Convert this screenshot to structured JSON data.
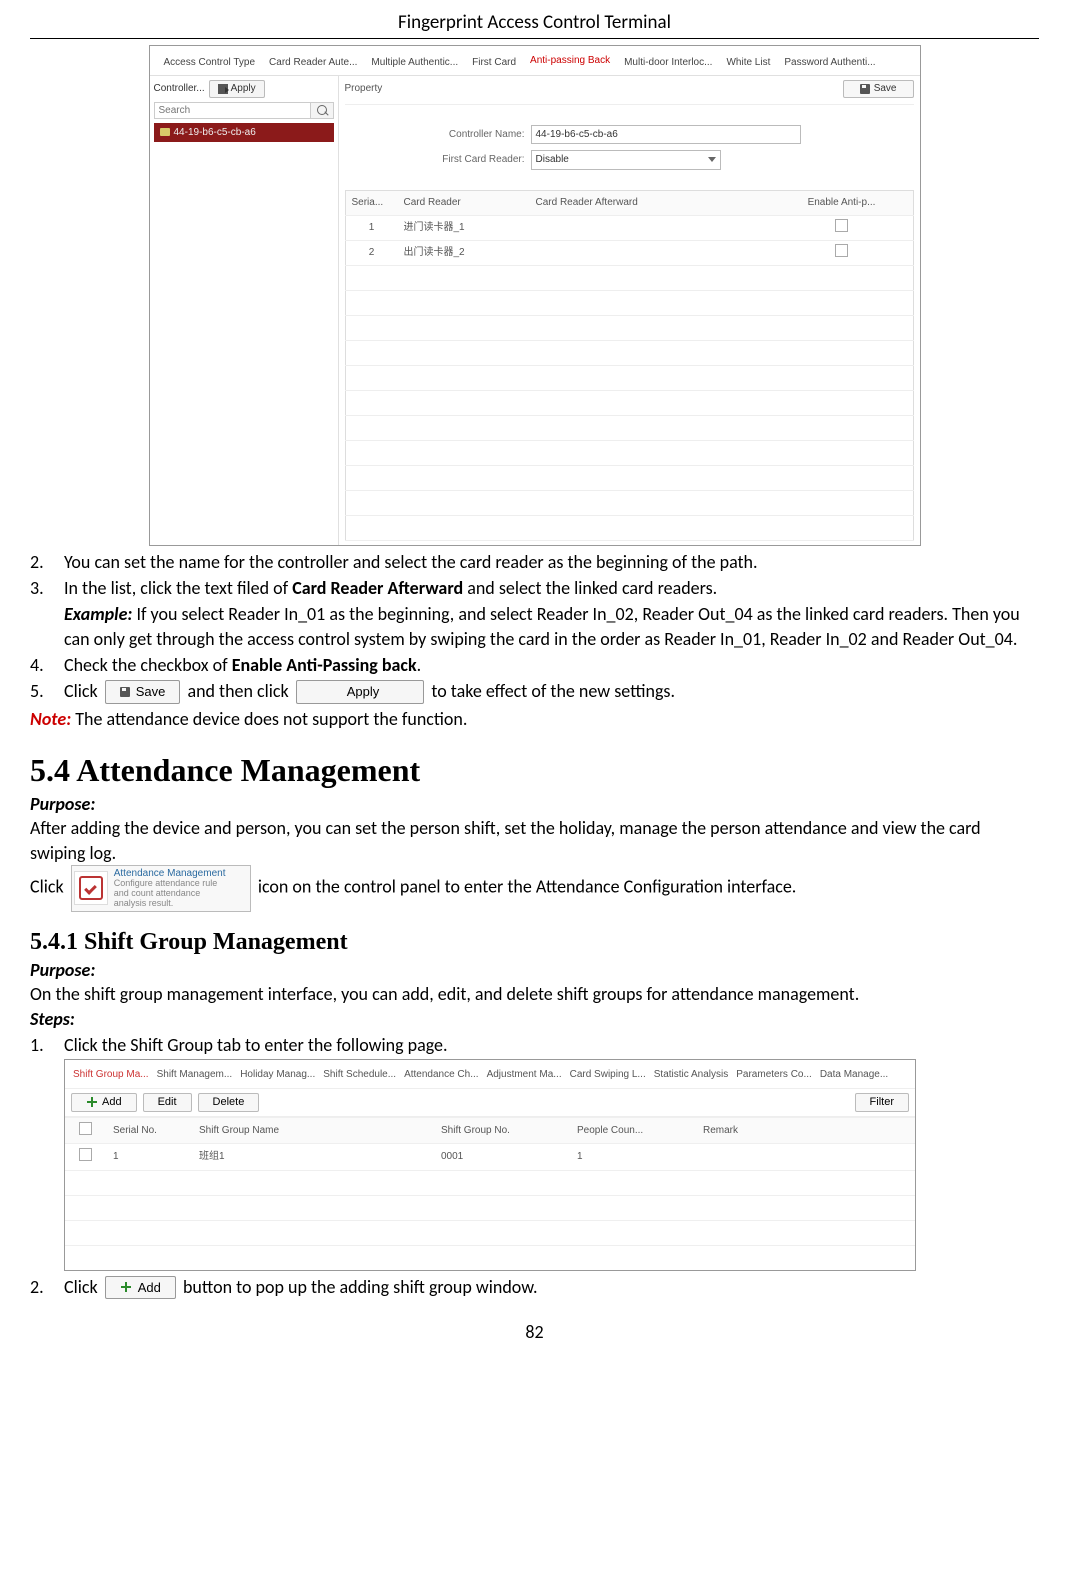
{
  "doc": {
    "header": "Fingerprint Access Control Terminal",
    "pageNumber": "82"
  },
  "panel": {
    "tabs": {
      "t0": "Access Control Type",
      "t1": "Card Reader Aute...",
      "t2": "Multiple Authentic...",
      "t3": "First Card",
      "t4": "Anti-passing Back",
      "t5": "Multi-door Interloc...",
      "t6": "White List",
      "t7": "Password Authenti..."
    },
    "leftLabel": "Controller...",
    "applyLabel": "Apply",
    "searchPlaceholder": "Search",
    "treeItem": "44-19-b6-c5-cb-a6",
    "propTitle": "Property",
    "saveLabel": "Save",
    "form": {
      "controllerNameLabel": "Controller Name:",
      "controllerNameValue": "44-19-b6-c5-cb-a6",
      "firstCardReaderLabel": "First Card Reader:",
      "firstCardReaderValue": "Disable"
    },
    "table": {
      "h0": "Seria...",
      "h1": "Card Reader",
      "h2": "Card Reader Afterward",
      "h3": "Enable Anti-p...",
      "rows": [
        {
          "n": "1",
          "reader": "进门读卡器_1"
        },
        {
          "n": "2",
          "reader": "出门读卡器_2"
        }
      ]
    }
  },
  "text": {
    "it2n": "2.",
    "it2": "You can set the name for the controller and select the card reader as the beginning of the path.",
    "it3n": "3.",
    "it3a": "In the list, click the text filed of ",
    "it3b": "Card Reader Afterward",
    "it3c": " and select the linked card readers.",
    "it3exLabel": "Example:",
    "it3ex": " If you select Reader In_01 as the beginning, and select Reader In_02, Reader Out_04 as the linked card readers. Then you can only get through the access control system by swiping the card in the order as Reader In_01, Reader In_02 and Reader Out_04.",
    "it4n": "4.",
    "it4a": "Check the checkbox of ",
    "it4b": "Enable Anti-Passing back",
    "it4c": ".",
    "it5n": "5.",
    "it5a": "Click ",
    "it5b": " and then click ",
    "it5c": " to take effect of the new settings.",
    "saveBtn": "Save",
    "applyBtn": "Apply",
    "noteLabel": "Note:",
    "noteText": " The attendance device does not support the function.",
    "h54": "5.4 Attendance Management",
    "purposeLabel": "Purpose:",
    "p54": "After adding the device and person, you can set the person shift, set the holiday, manage the person attendance and view the card swiping log.",
    "clickWord": "Click ",
    "cpTitle": "Attendance Management",
    "cpSub1": "Configure attendance rule",
    "cpSub2": "and count attendance",
    "cpSub3": "analysis result.",
    "p54b": " icon on the control panel to enter the Attendance Configuration interface.",
    "h541": "5.4.1   Shift Group Management",
    "p541": "On the shift group management interface, you can add, edit, and delete shift groups for attendance management.",
    "stepsLabel": "Steps:",
    "s1n": "1.",
    "s1": "Click the Shift Group tab to enter the following page.",
    "s2n": "2.",
    "s2a": "Click ",
    "addBtn": "Add",
    "s2b": " button to pop up the adding shift group window."
  },
  "shift": {
    "tabs": {
      "t0": "Shift Group Ma...",
      "t1": "Shift Managem...",
      "t2": "Holiday Manag...",
      "t3": "Shift Schedule...",
      "t4": "Attendance Ch...",
      "t5": "Adjustment Ma...",
      "t6": "Card Swiping L...",
      "t7": "Statistic Analysis",
      "t8": "Parameters Co...",
      "t9": "Data Manage..."
    },
    "addLabel": "Add",
    "editLabel": "Edit",
    "deleteLabel": "Delete",
    "filterLabel": "Filter",
    "headers": {
      "h0": "",
      "h1": "Serial No.",
      "h2": "Shift Group Name",
      "h3": "Shift Group No.",
      "h4": "People Coun...",
      "h5": "Remark"
    },
    "row": {
      "serial": "1",
      "name": "班组1",
      "no": "0001",
      "count": "1",
      "remark": ""
    }
  }
}
